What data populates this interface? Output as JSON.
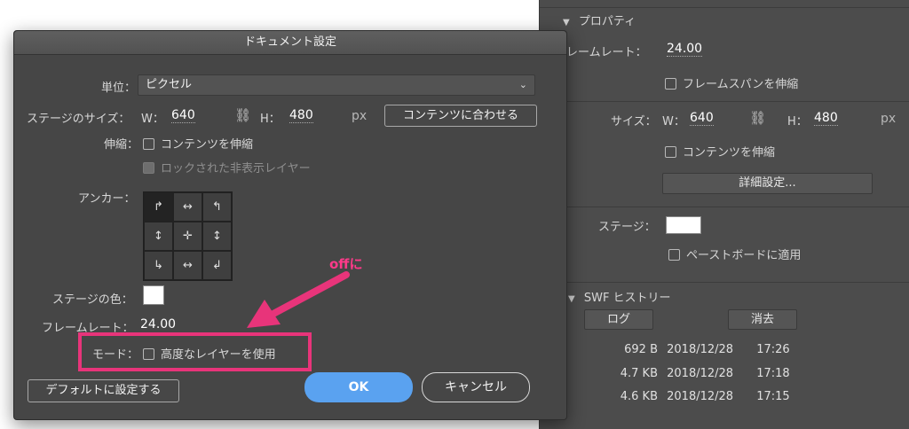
{
  "panel": {
    "section_title": "プロパティ",
    "framerate_label": "レームレート：",
    "framerate_value": "24.00",
    "framespan_checkbox": "フレームスパンを伸縮",
    "size_label": "サイズ：",
    "w_label": "W：",
    "w_value": "640",
    "h_label": "H：",
    "h_value": "480",
    "px": "px",
    "scale_content_checkbox": "コンテンツを伸縮",
    "advanced_button": "詳細設定...",
    "stage_label": "ステージ：",
    "pasteboard_checkbox": "ペーストボードに適用",
    "swf_history_title": "SWF ヒストリー",
    "log_button": "ログ",
    "clear_button": "消去",
    "history": [
      {
        "size": "692 B",
        "date": "2018/12/28",
        "time": "17:26"
      },
      {
        "size": "4.7 KB",
        "date": "2018/12/28",
        "time": "17:18"
      },
      {
        "size": "4.6 KB",
        "date": "2018/12/28",
        "time": "17:15"
      }
    ]
  },
  "dialog": {
    "title": "ドキュメント設定",
    "units_label": "単位：",
    "units_value": "ピクセル",
    "stage_size_label": "ステージのサイズ：",
    "w_label": "W：",
    "w_value": "640",
    "h_label": "H：",
    "h_value": "480",
    "px": "px",
    "match_contents_button": "コンテンツに合わせる",
    "scale_label": "伸縮：",
    "scale_contents_checkbox": "コンテンツを伸縮",
    "locked_hidden_checkbox": "ロックされた非表示レイヤー",
    "anchor_label": "アンカー：",
    "anchor_glyphs": [
      "↱",
      "↔",
      "↰",
      "↕",
      "✛",
      "↕",
      "↳",
      "↔",
      "↲"
    ],
    "stage_color_label": "ステージの色：",
    "framerate_label": "フレームレート：",
    "framerate_value": "24.00",
    "mode_label": "モード：",
    "advanced_layers_checkbox": "高度なレイヤーを使用",
    "default_button": "デフォルトに設定する",
    "ok_button": "OK",
    "cancel_button": "キャンセル"
  },
  "annotation": {
    "note": "offに",
    "color": "#e8347a"
  },
  "colors": {
    "ok_blue": "#5aa2f0",
    "dialog_bg": "#464646",
    "panel_bg": "#4c4c4c"
  }
}
